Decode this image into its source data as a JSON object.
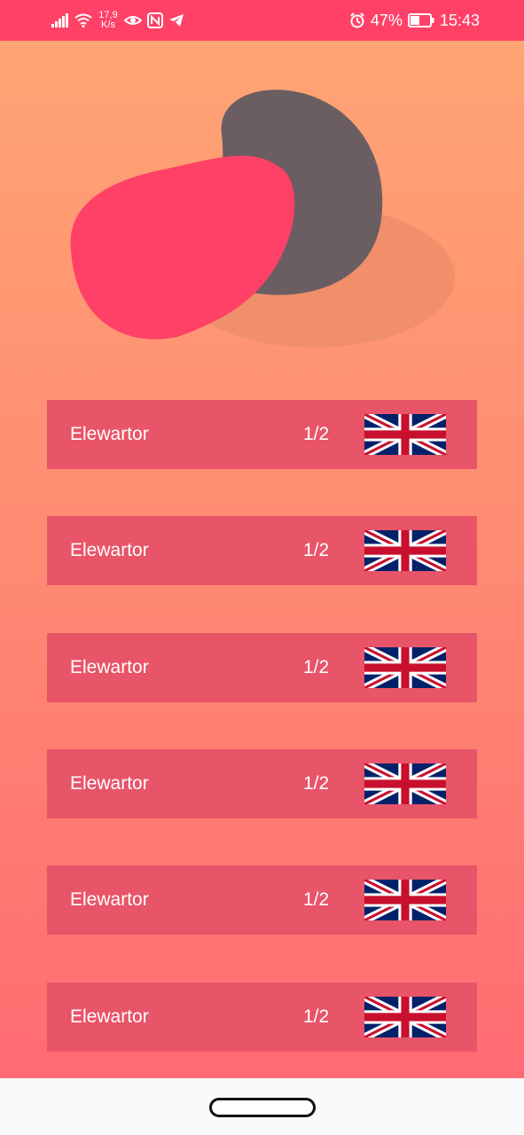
{
  "status_bar": {
    "net_speed_value": "17,9",
    "net_speed_unit": "K/s",
    "battery_percent": "47%",
    "time": "15:43",
    "icons": [
      "signal-icon",
      "wifi-icon",
      "eye-icon",
      "nfc-icon",
      "telegram-icon",
      "alarm-icon",
      "battery-icon"
    ]
  },
  "items": [
    {
      "label": "Elewartor",
      "count": "1/2",
      "flag": "uk-flag-icon"
    },
    {
      "label": "Elewartor",
      "count": "1/2",
      "flag": "uk-flag-icon"
    },
    {
      "label": "Elewartor",
      "count": "1/2",
      "flag": "uk-flag-icon"
    },
    {
      "label": "Elewartor",
      "count": "1/2",
      "flag": "uk-flag-icon"
    },
    {
      "label": "Elewartor",
      "count": "1/2",
      "flag": "uk-flag-icon"
    },
    {
      "label": "Elewartor",
      "count": "1/2",
      "flag": "uk-flag-icon"
    }
  ],
  "colors": {
    "status_bar": "#ff4168",
    "background_top": "#ffa474",
    "background_bottom": "#ff6b73",
    "item_background": "#e85468",
    "blob_pink": "#ff4168",
    "blob_gray": "#6b5e62"
  }
}
